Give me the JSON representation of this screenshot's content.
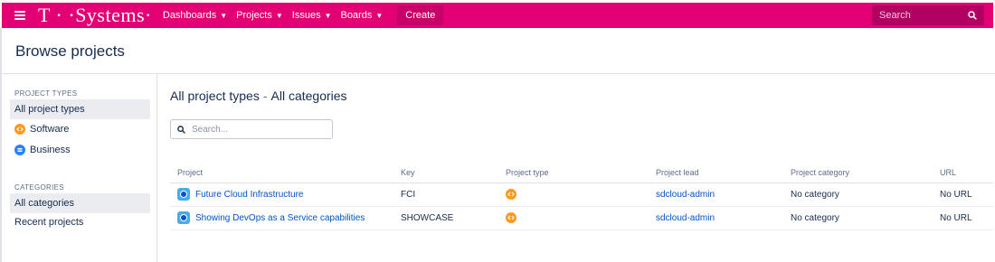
{
  "colors": {
    "brand": "#e20074",
    "link": "#0052cc",
    "software": "#ff991f",
    "business": "#2684ff"
  },
  "topbar": {
    "brand": "T · ·Systems·",
    "menu_icon": "hamburger-icon",
    "nav": [
      {
        "label": "Dashboards"
      },
      {
        "label": "Projects"
      },
      {
        "label": "Issues"
      },
      {
        "label": "Boards"
      }
    ],
    "create_label": "Create",
    "search_placeholder": "Search",
    "search_icon": "search-icon"
  },
  "page": {
    "title": "Browse projects"
  },
  "sidebar": {
    "project_types_heading": "PROJECT TYPES",
    "project_types": [
      {
        "label": "All project types",
        "active": true
      },
      {
        "label": "Software",
        "icon": "software-icon"
      },
      {
        "label": "Business",
        "icon": "business-icon"
      }
    ],
    "categories_heading": "CATEGORIES",
    "categories": [
      {
        "label": "All categories",
        "active": true
      },
      {
        "label": "Recent projects"
      }
    ]
  },
  "main": {
    "title_types": "All project types",
    "title_sep": "-",
    "title_categories": "All categories",
    "filter_placeholder": "Search...",
    "columns": [
      "Project",
      "Key",
      "Project type",
      "Project lead",
      "Project category",
      "URL"
    ],
    "rows": [
      {
        "project": "Future Cloud Infrastructure",
        "key": "FCI",
        "type_icon": "software-icon",
        "lead": "sdcloud-admin",
        "category": "No category",
        "url": "No URL"
      },
      {
        "project": "Showing DevOps as a Service capabilities",
        "key": "SHOWCASE",
        "type_icon": "software-icon",
        "lead": "sdcloud-admin",
        "category": "No category",
        "url": "No URL"
      }
    ]
  }
}
